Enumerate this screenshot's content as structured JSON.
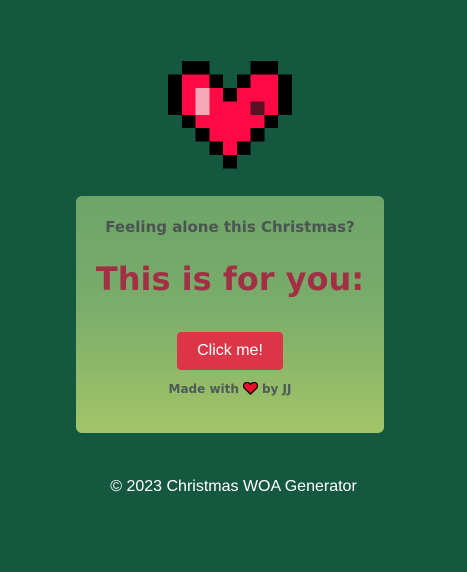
{
  "hero": {
    "icon": "pixel-heart-icon"
  },
  "card": {
    "subtitle": "Feeling alone this Christmas?",
    "headline": "This is for you:",
    "button_label": "Click me!",
    "made_with_prefix": "Made with",
    "made_with_icon": "heart-icon",
    "made_with_suffix": "by JJ"
  },
  "footer": {
    "text": "© 2023 Christmas WOA Generator"
  },
  "colors": {
    "page_background": "#145840",
    "card_gradient_top": "#6da469",
    "card_gradient_bottom": "#a2c468",
    "headline": "#a23044",
    "button": "#dd3548",
    "heart_red": "#ff0a45",
    "heart_highlight": "#f5a9b8",
    "heart_shadow": "#5a1023"
  }
}
